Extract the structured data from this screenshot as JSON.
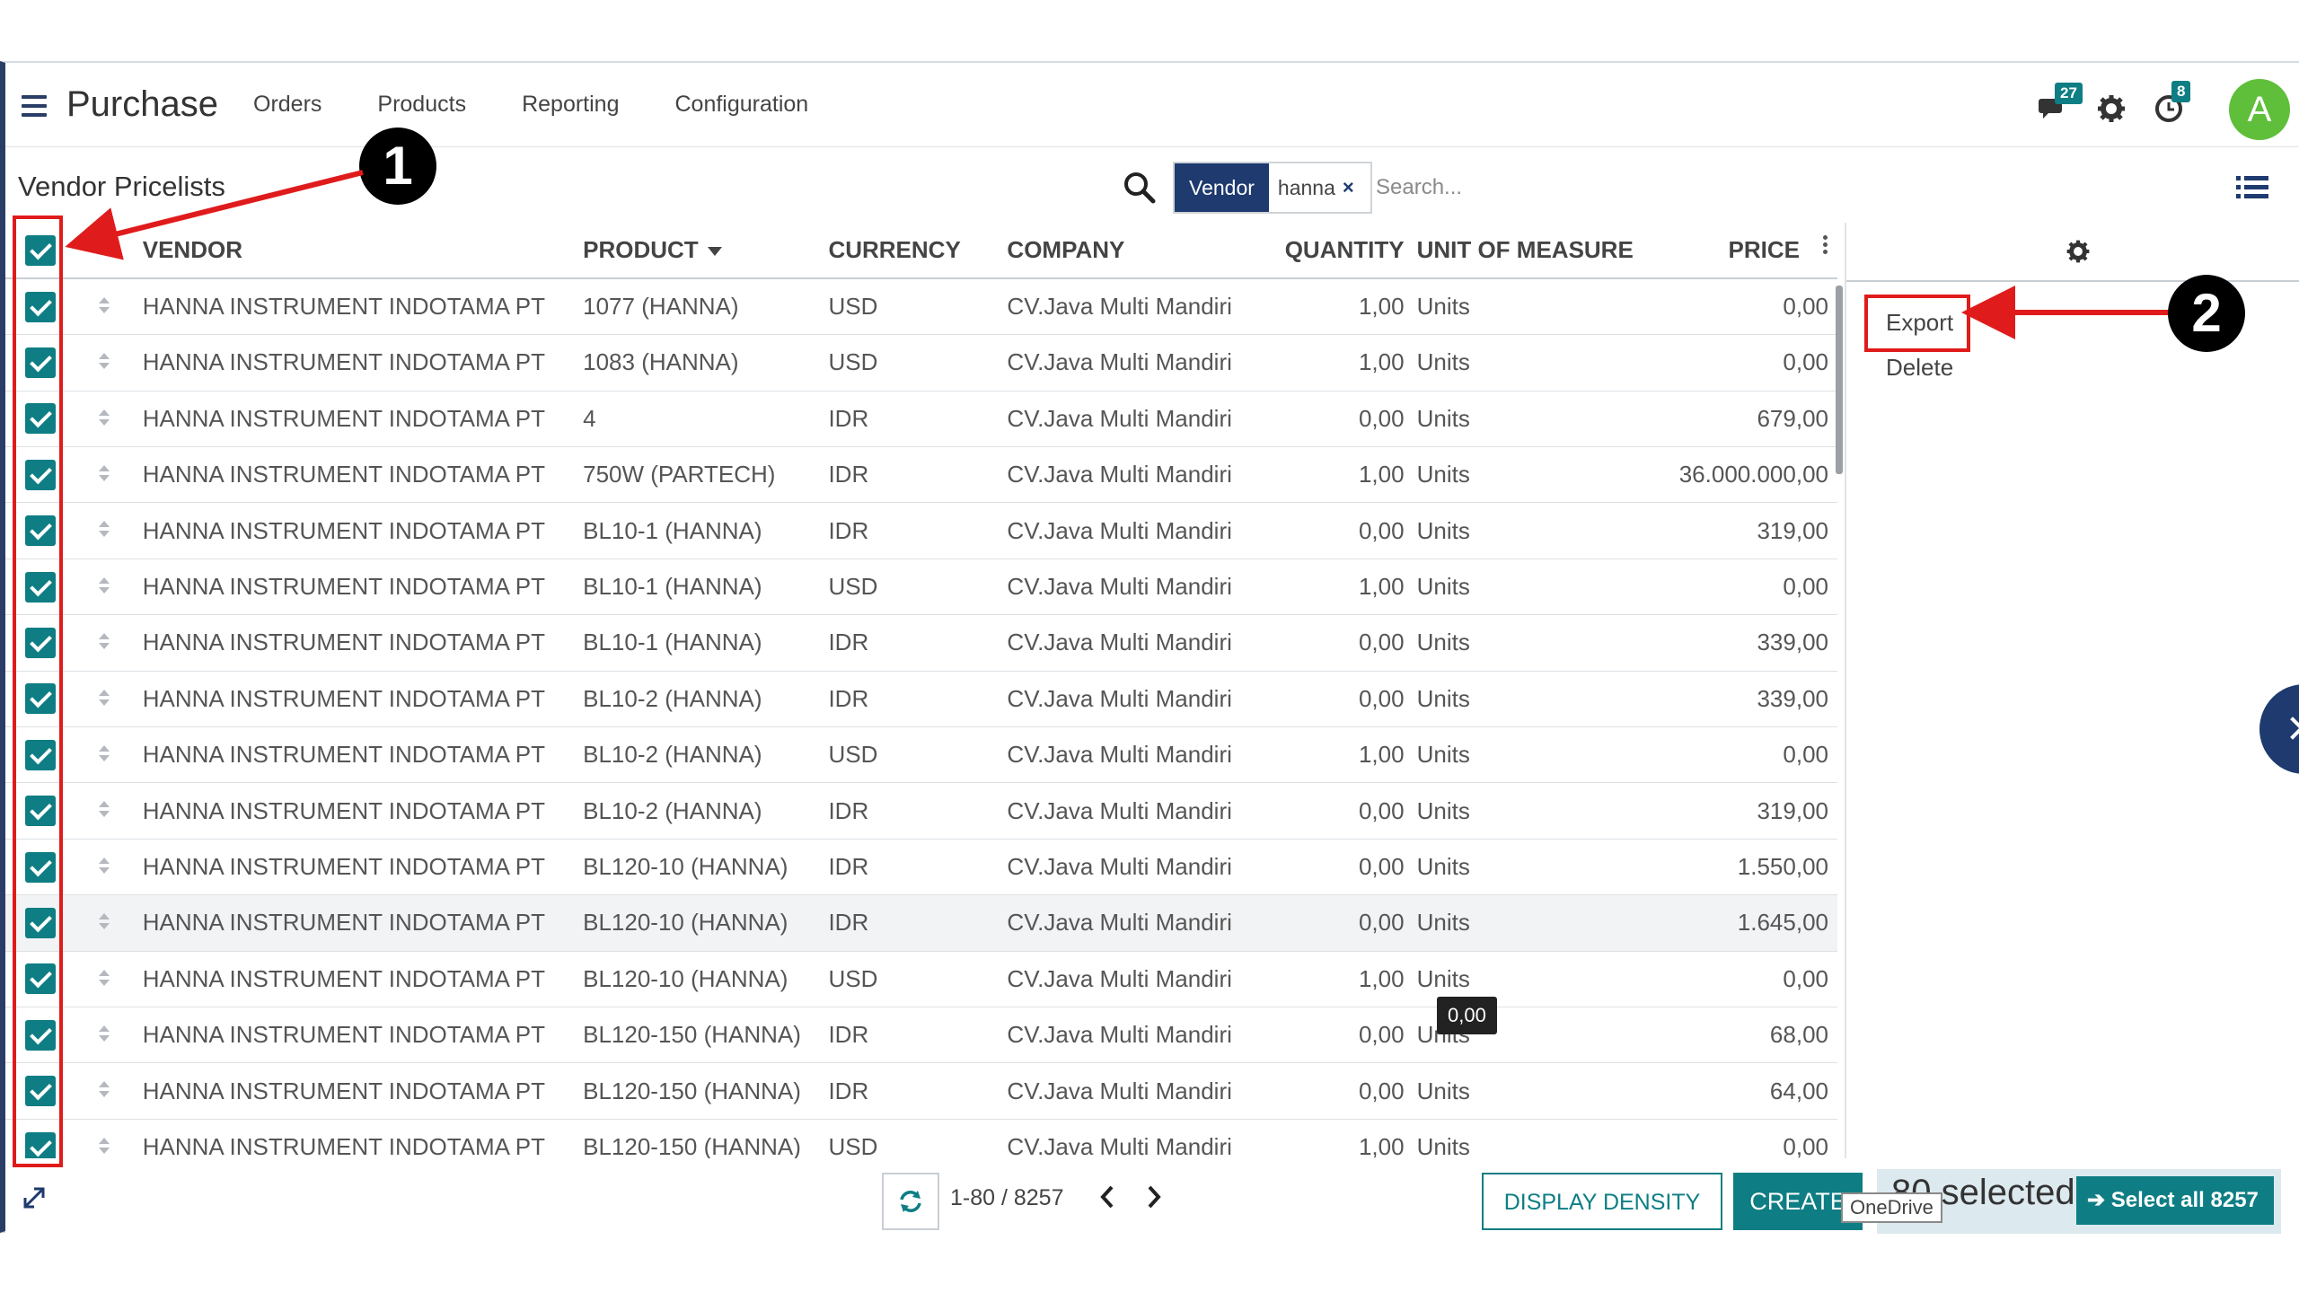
{
  "app": {
    "title": "Purchase",
    "menu": [
      "Orders",
      "Products",
      "Reporting",
      "Configuration"
    ],
    "messages_badge": "27",
    "activities_badge": "8",
    "avatar_letter": "A"
  },
  "control": {
    "page_title": "Vendor Pricelists",
    "facet_label": "Vendor",
    "facet_value": "hanna",
    "facet_remove": "×",
    "search_placeholder": "Search..."
  },
  "table": {
    "headers": [
      "VENDOR",
      "PRODUCT",
      "CURRENCY",
      "COMPANY",
      "QUANTITY",
      "UNIT OF MEASURE",
      "PRICE"
    ],
    "rows": [
      [
        "HANNA INSTRUMENT INDOTAMA PT",
        "1077 (HANNA)",
        "USD",
        "CV.Java Multi Mandiri",
        "1,00",
        "Units",
        "0,00"
      ],
      [
        "HANNA INSTRUMENT INDOTAMA PT",
        "1083 (HANNA)",
        "USD",
        "CV.Java Multi Mandiri",
        "1,00",
        "Units",
        "0,00"
      ],
      [
        "HANNA INSTRUMENT INDOTAMA PT",
        "4",
        "IDR",
        "CV.Java Multi Mandiri",
        "0,00",
        "Units",
        "679,00"
      ],
      [
        "HANNA INSTRUMENT INDOTAMA PT",
        "750W (PARTECH)",
        "IDR",
        "CV.Java Multi Mandiri",
        "1,00",
        "Units",
        "36.000.000,00"
      ],
      [
        "HANNA INSTRUMENT INDOTAMA PT",
        "BL10-1 (HANNA)",
        "IDR",
        "CV.Java Multi Mandiri",
        "0,00",
        "Units",
        "319,00"
      ],
      [
        "HANNA INSTRUMENT INDOTAMA PT",
        "BL10-1 (HANNA)",
        "USD",
        "CV.Java Multi Mandiri",
        "1,00",
        "Units",
        "0,00"
      ],
      [
        "HANNA INSTRUMENT INDOTAMA PT",
        "BL10-1 (HANNA)",
        "IDR",
        "CV.Java Multi Mandiri",
        "0,00",
        "Units",
        "339,00"
      ],
      [
        "HANNA INSTRUMENT INDOTAMA PT",
        "BL10-2 (HANNA)",
        "IDR",
        "CV.Java Multi Mandiri",
        "0,00",
        "Units",
        "339,00"
      ],
      [
        "HANNA INSTRUMENT INDOTAMA PT",
        "BL10-2 (HANNA)",
        "USD",
        "CV.Java Multi Mandiri",
        "1,00",
        "Units",
        "0,00"
      ],
      [
        "HANNA INSTRUMENT INDOTAMA PT",
        "BL10-2 (HANNA)",
        "IDR",
        "CV.Java Multi Mandiri",
        "0,00",
        "Units",
        "319,00"
      ],
      [
        "HANNA INSTRUMENT INDOTAMA PT",
        "BL120-10 (HANNA)",
        "IDR",
        "CV.Java Multi Mandiri",
        "0,00",
        "Units",
        "1.550,00"
      ],
      [
        "HANNA INSTRUMENT INDOTAMA PT",
        "BL120-10 (HANNA)",
        "IDR",
        "CV.Java Multi Mandiri",
        "0,00",
        "Units",
        "1.645,00"
      ],
      [
        "HANNA INSTRUMENT INDOTAMA PT",
        "BL120-10 (HANNA)",
        "USD",
        "CV.Java Multi Mandiri",
        "1,00",
        "Units",
        "0,00"
      ],
      [
        "HANNA INSTRUMENT INDOTAMA PT",
        "BL120-150 (HANNA)",
        "IDR",
        "CV.Java Multi Mandiri",
        "0,00",
        "Units",
        "68,00"
      ],
      [
        "HANNA INSTRUMENT INDOTAMA PT",
        "BL120-150 (HANNA)",
        "IDR",
        "CV.Java Multi Mandiri",
        "0,00",
        "Units",
        "64,00"
      ],
      [
        "HANNA INSTRUMENT INDOTAMA PT",
        "BL120-150 (HANNA)",
        "USD",
        "CV.Java Multi Mandiri",
        "1,00",
        "Units",
        "0,00"
      ]
    ],
    "hover_row_index": 11,
    "tooltip": "0,00"
  },
  "side_panel": {
    "actions": [
      "Export",
      "Delete"
    ]
  },
  "bottom": {
    "pager": "1-80 / 8257",
    "display_density_label": "DISPLAY DENSITY",
    "create_label": "CREATE",
    "selected_text": "80 selected",
    "select_all_label": "Select all 8257",
    "onedrive_tooltip": "OneDrive"
  },
  "annotations": {
    "step1": "1",
    "step2": "2"
  },
  "colors": {
    "brand_dark": "#1e3a6e",
    "accent_teal": "#0e7e84",
    "annotation_red": "#e01b1b",
    "avatar_green": "#5fbf3a"
  },
  "icons": [
    "hamburger-icon",
    "chat-icon",
    "gear-icon",
    "clock-icon",
    "search-icon",
    "list-view-icon",
    "checkbox-checked-icon",
    "drag-handle-icon",
    "reload-icon",
    "chevron-left-icon",
    "chevron-right-icon",
    "expand-icon",
    "arrow-right-icon"
  ]
}
